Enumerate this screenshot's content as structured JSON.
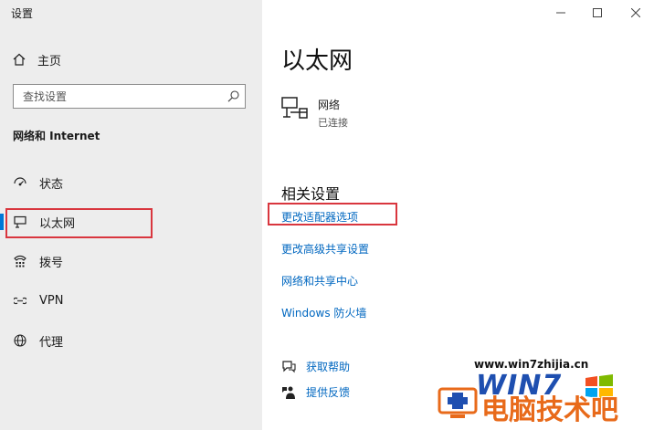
{
  "window": {
    "title": "设置",
    "minimize_icon": "minimize-icon",
    "maximize_icon": "maximize-icon",
    "close_icon": "close-icon"
  },
  "sidebar": {
    "home_label": "主页",
    "search": {
      "placeholder": "查找设置",
      "value": ""
    },
    "section_header": "网络和 Internet",
    "items": [
      {
        "label": "状态",
        "icon": "status-icon",
        "selected": false
      },
      {
        "label": "以太网",
        "icon": "ethernet-icon",
        "selected": true
      },
      {
        "label": "拨号",
        "icon": "dialup-icon",
        "selected": false
      },
      {
        "label": "VPN",
        "icon": "vpn-icon",
        "selected": false
      },
      {
        "label": "代理",
        "icon": "proxy-icon",
        "selected": false
      }
    ]
  },
  "main": {
    "title": "以太网",
    "network": {
      "name": "网络",
      "status": "已连接",
      "icon": "ethernet-network-icon"
    },
    "related_title": "相关设置",
    "links": [
      "更改适配器选项",
      "更改高级共享设置",
      "网络和共享中心",
      "Windows 防火墙"
    ],
    "help": {
      "get_help": "获取帮助",
      "feedback": "提供反馈"
    }
  },
  "watermark": {
    "url": "www.win7zhijia.cn",
    "logo_text": "WIN7",
    "brand": "电脑技术吧"
  },
  "colors": {
    "accent": "#0078d7",
    "link": "#0067c0",
    "highlight_box": "#d9363e",
    "sidebar_bg": "#ededed"
  }
}
